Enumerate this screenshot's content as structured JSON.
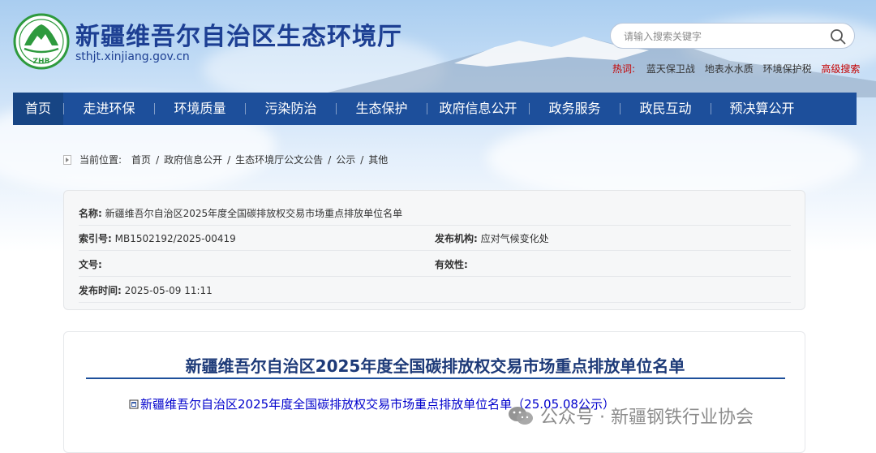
{
  "header": {
    "title": "新疆维吾尔自治区生态环境厅",
    "domain": "sthjt.xinjiang.gov.cn",
    "logo_text": "ZHB"
  },
  "search": {
    "placeholder": "请输入搜索关键字"
  },
  "hot": {
    "label": "热词:",
    "links": [
      "蓝天保卫战",
      "地表水水质",
      "环境保护税"
    ],
    "advanced": "高级搜索"
  },
  "nav": {
    "items": [
      "首页",
      "走进环保",
      "环境质量",
      "污染防治",
      "生态保护",
      "政府信息公开",
      "政务服务",
      "政民互动",
      "预决算公开"
    ],
    "active_index": 0
  },
  "breadcrumb": {
    "prefix": "当前位置:",
    "items": [
      "首页",
      "政府信息公开",
      "生态环境厅公文公告",
      "公示",
      "其他"
    ],
    "separator": "/"
  },
  "info": {
    "name_label": "名称:",
    "name_value": "新疆维吾尔自治区2025年度全国碳排放权交易市场重点排放单位名单",
    "index_label": "索引号:",
    "index_value": "MB1502192/2025-00419",
    "org_label": "发布机构:",
    "org_value": "应对气候变化处",
    "doc_label": "文号:",
    "doc_value": "",
    "validity_label": "有效性:",
    "validity_value": "",
    "time_label": "发布时间:",
    "time_value": "2025-05-09 11:11"
  },
  "article": {
    "title": "新疆维吾尔自治区2025年度全国碳排放权交易市场重点排放单位名单",
    "attachment": "新疆维吾尔自治区2025年度全国碳排放权交易市场重点排放单位名单（25.05.08公示）"
  },
  "watermark": {
    "text": "公众号 · 新疆钢铁行业协会"
  },
  "colors": {
    "nav_bg": "#1d4f9b",
    "title_blue": "#1d3f93",
    "hot_red": "#c40000",
    "link_blue": "#0000cc",
    "logo_green": "#2e9a3e"
  }
}
